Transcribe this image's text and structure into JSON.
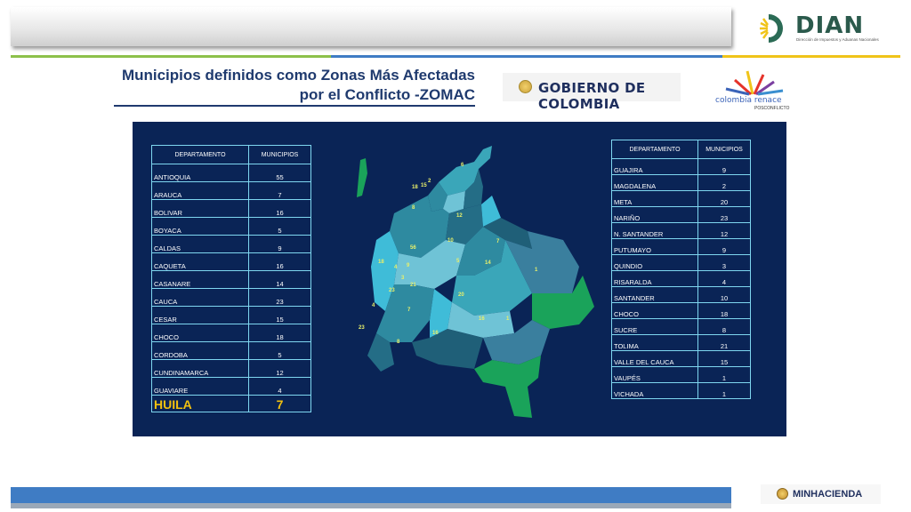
{
  "header": {
    "title_line1": "Municipios definidos como Zonas Más Afectadas",
    "title_line2": "por el Conflicto -ZOMAC"
  },
  "logos": {
    "dian_name": "DIAN",
    "dian_subtitle": "Dirección de Impuestos y Aduanas Nacionales",
    "gobierno": "GOBIERNO DE COLOMBIA",
    "renace": "colombia renace",
    "renace_sub": "POSCONFLICTO",
    "minhacienda": "MINHACIENDA"
  },
  "left_table": {
    "col_departamento": "DEPARTAMENTO",
    "col_municipios": "MUNICIPIOS",
    "rows": [
      {
        "dept": "ANTIOQUIA",
        "n": "55"
      },
      {
        "dept": "ARAUCA",
        "n": "7"
      },
      {
        "dept": "BOLIVAR",
        "n": "16"
      },
      {
        "dept": "BOYACA",
        "n": "5"
      },
      {
        "dept": "CALDAS",
        "n": "9"
      },
      {
        "dept": "CAQUETA",
        "n": "16"
      },
      {
        "dept": "CASANARE",
        "n": "14"
      },
      {
        "dept": "CAUCA",
        "n": "23"
      },
      {
        "dept": "CESAR",
        "n": "15"
      },
      {
        "dept": "CHOCO",
        "n": "18"
      },
      {
        "dept": "CORDOBA",
        "n": "5"
      },
      {
        "dept": "CUNDINAMARCA",
        "n": "12"
      },
      {
        "dept": "GUAVIARE",
        "n": "4"
      }
    ],
    "highlight": {
      "dept": "HUILA",
      "n": "7"
    }
  },
  "right_table": {
    "col_departamento": "DEPARTAMENTO",
    "col_municipios": "MUNICIPIOS",
    "rows": [
      {
        "dept": "GUAJIRA",
        "n": "9"
      },
      {
        "dept": "MAGDALENA",
        "n": "2"
      },
      {
        "dept": "META",
        "n": "20"
      },
      {
        "dept": "NARIÑO",
        "n": "23"
      },
      {
        "dept": "N. SANTANDER",
        "n": "12"
      },
      {
        "dept": "PUTUMAYO",
        "n": "9"
      },
      {
        "dept": "QUINDIO",
        "n": "3"
      },
      {
        "dept": "RISARALDA",
        "n": "4"
      },
      {
        "dept": "SANTANDER",
        "n": "10"
      },
      {
        "dept": "CHOCO",
        "n": "18"
      },
      {
        "dept": "SUCRE",
        "n": "8"
      },
      {
        "dept": "TOLIMA",
        "n": "21"
      },
      {
        "dept": "VALLE DEL CAUCA",
        "n": "15"
      },
      {
        "dept": "VAUPÉS",
        "n": "1"
      },
      {
        "dept": "VICHADA",
        "n": "1"
      }
    ]
  },
  "map_labels": [
    "6",
    "2",
    "18",
    "15",
    "8",
    "12",
    "10",
    "7",
    "56",
    "14",
    "1",
    "18",
    "4",
    "9",
    "3",
    "5",
    "21",
    "23",
    "20",
    "7",
    "16",
    "4",
    "1",
    "23",
    "8",
    "16"
  ]
}
